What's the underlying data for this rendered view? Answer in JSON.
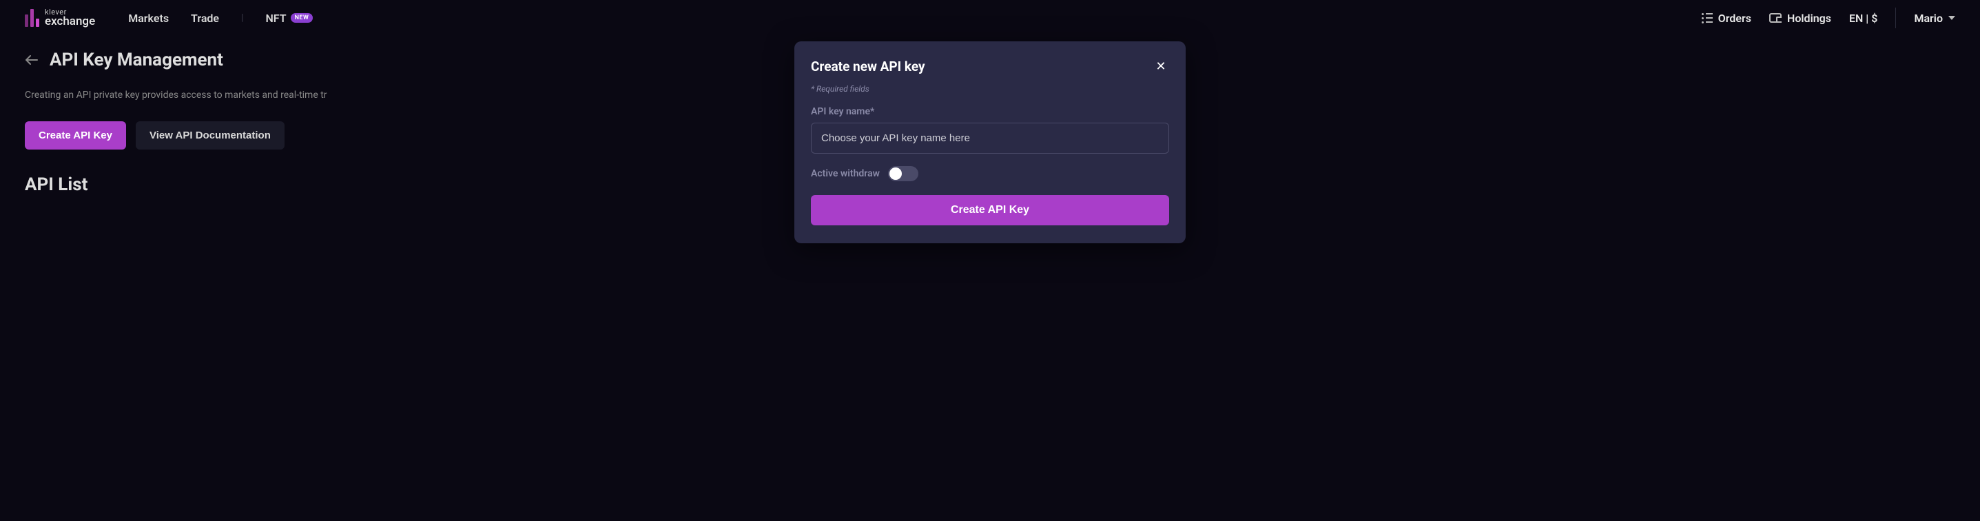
{
  "logo": {
    "top": "klever",
    "bottom": "exchange"
  },
  "nav": {
    "markets": "Markets",
    "trade": "Trade",
    "nft": "NFT",
    "nft_badge": "NEW"
  },
  "header_right": {
    "orders": "Orders",
    "holdings": "Holdings",
    "lang": "EN | $",
    "user": "Mario"
  },
  "page": {
    "title": "API Key Management",
    "desc": "Creating an API private key provides access to markets and real-time tr",
    "create_btn": "Create API Key",
    "docs_btn": "View API Documentation",
    "list_title": "API List"
  },
  "modal": {
    "title": "Create new API key",
    "hint": "* Required fields",
    "name_label": "API key name*",
    "name_placeholder": "Choose your API key name here",
    "toggle_label": "Active withdraw",
    "submit": "Create API Key"
  }
}
